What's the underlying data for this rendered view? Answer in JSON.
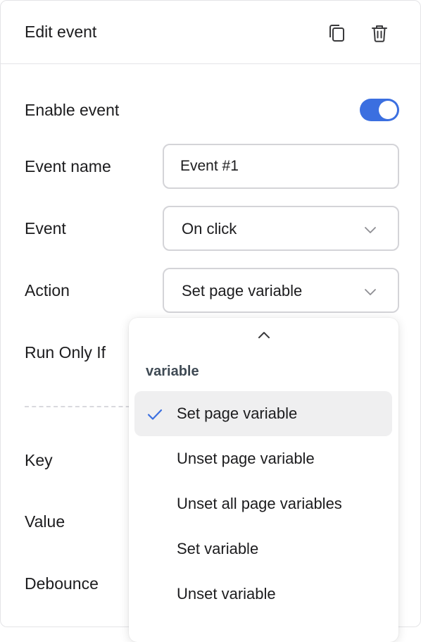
{
  "header": {
    "title": "Edit event",
    "icons": [
      "copy-icon",
      "trash-icon"
    ]
  },
  "form": {
    "enable_event": {
      "label": "Enable event",
      "on": true
    },
    "event_name": {
      "label": "Event name",
      "value": "Event #1"
    },
    "event": {
      "label": "Event",
      "value": "On click",
      "icon": "chevron-down-icon"
    },
    "action": {
      "label": "Action",
      "value": "Set page variable",
      "icon": "chevron-down-icon"
    },
    "run_only_if": {
      "label": "Run Only If"
    },
    "key": {
      "label": "Key"
    },
    "value": {
      "label": "Value"
    },
    "debounce": {
      "label": "Debounce"
    }
  },
  "dropdown": {
    "group_label": "variable",
    "scroll_icon": "chevron-up-icon",
    "items": [
      {
        "label": "Set page variable",
        "selected": true
      },
      {
        "label": "Unset page variable",
        "selected": false
      },
      {
        "label": "Unset all page variables",
        "selected": false
      },
      {
        "label": "Set variable",
        "selected": false
      },
      {
        "label": "Unset variable",
        "selected": false
      }
    ]
  },
  "colors": {
    "accent": "#3b6fe0",
    "border": "#d4d4d8",
    "selected_bg": "#efeff0"
  }
}
